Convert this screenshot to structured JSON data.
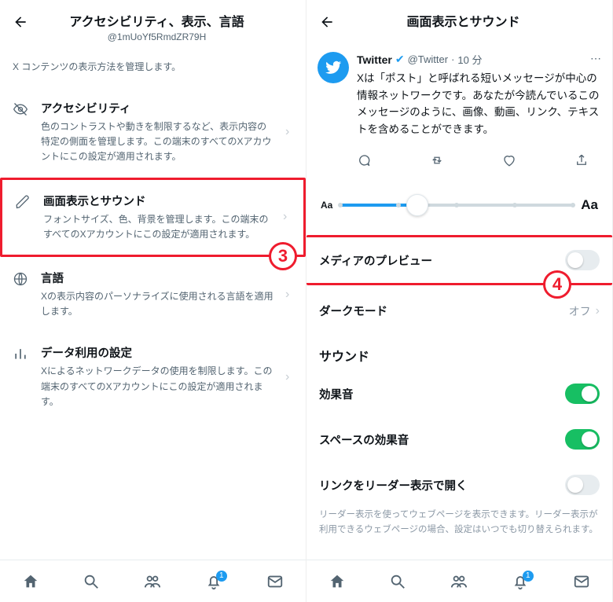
{
  "left": {
    "header": {
      "title": "アクセシビリティ、表示、言語",
      "handle": "@1mUoYf5RmdZR79H"
    },
    "intro": "X コンテンツの表示方法を管理します。",
    "items": [
      {
        "icon": "eye-off-icon",
        "title": "アクセシビリティ",
        "desc": "色のコントラストや動きを制限するなど、表示内容の特定の側面を管理します。この端末のすべてのXアカウントにこの設定が適用されます。"
      },
      {
        "icon": "pencil-icon",
        "title": "画面表示とサウンド",
        "desc": "フォントサイズ、色、背景を管理します。この端末のすべてのXアカウントにこの設定が適用されます。"
      },
      {
        "icon": "globe-icon",
        "title": "言語",
        "desc": "Xの表示内容のパーソナライズに使用される言語を適用します。"
      },
      {
        "icon": "bars-icon",
        "title": "データ利用の設定",
        "desc": "Xによるネットワークデータの使用を制限します。この端末のすべてのXアカウントにこの設定が適用されます。"
      }
    ],
    "callout": "3"
  },
  "right": {
    "header": {
      "title": "画面表示とサウンド"
    },
    "tweet": {
      "name": "Twitter",
      "handle": "@Twitter",
      "time": "10 分",
      "text": "Xは「ポスト」と呼ばれる短いメッセージが中心の情報ネットワークです。あなたが今読んでいるこのメッセージのように、画像、動画、リンク、テキストを含めることができます。"
    },
    "slider": {
      "small": "Aa",
      "large": "Aa"
    },
    "rows": {
      "mediaPreview": {
        "label": "メディアのプレビュー",
        "on": false
      },
      "darkMode": {
        "label": "ダークモード",
        "value": "オフ"
      },
      "soundHeading": "サウンド",
      "sfx": {
        "label": "効果音",
        "on": true
      },
      "spaceSfx": {
        "label": "スペースの効果音",
        "on": true
      },
      "readerLink": {
        "label": "リンクをリーダー表示で開く",
        "on": false
      },
      "readerDesc": "リーダー表示を使ってウェブページを表示できます。リーダー表示が利用できるウェブページの場合、設定はいつでも切り替えられます。"
    },
    "callout": "4"
  },
  "nav": {
    "badge": "1"
  }
}
